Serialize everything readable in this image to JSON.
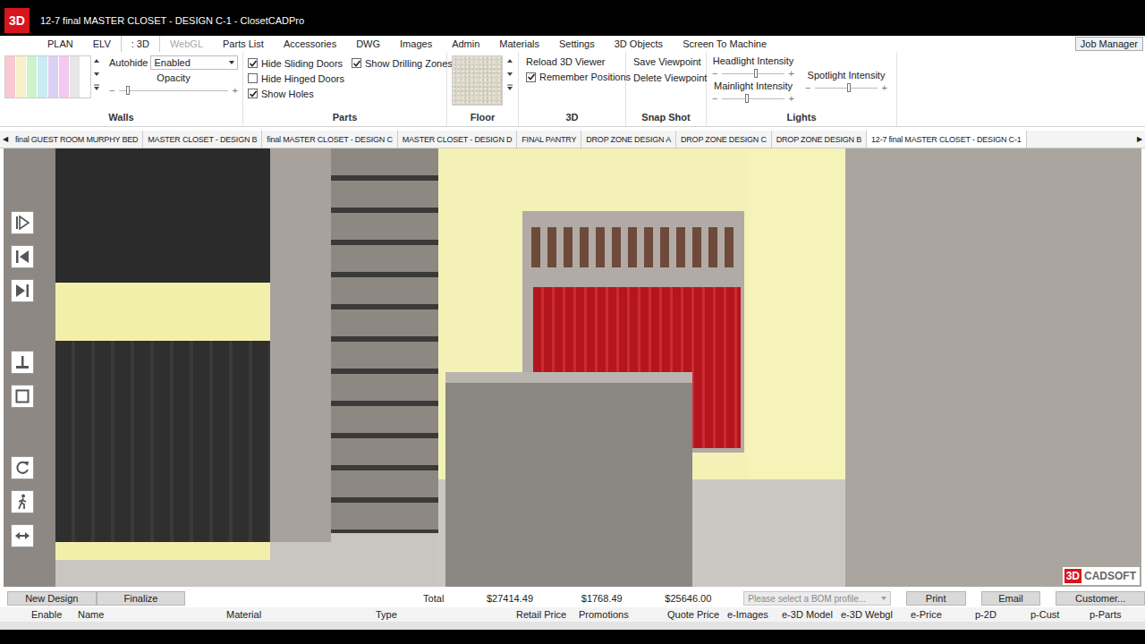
{
  "window": {
    "title": "12-7 final MASTER CLOSET - DESIGN C-1 - ClosetCADPro",
    "logo": "3D"
  },
  "menu": {
    "items": [
      {
        "label": "PLAN",
        "selected": false,
        "disabled": false
      },
      {
        "label": "ELV",
        "selected": false,
        "disabled": false
      },
      {
        "label": ": 3D",
        "selected": true,
        "disabled": false
      },
      {
        "label": "WebGL",
        "selected": false,
        "disabled": true
      },
      {
        "label": "Parts List",
        "selected": false,
        "disabled": false
      },
      {
        "label": "Accessories",
        "selected": false,
        "disabled": false
      },
      {
        "label": "DWG",
        "selected": false,
        "disabled": false
      },
      {
        "label": "Images",
        "selected": false,
        "disabled": false
      },
      {
        "label": "Admin",
        "selected": false,
        "disabled": false
      },
      {
        "label": "Materials",
        "selected": false,
        "disabled": false
      },
      {
        "label": "Settings",
        "selected": false,
        "disabled": false
      },
      {
        "label": "3D Objects",
        "selected": false,
        "disabled": false
      },
      {
        "label": "Screen To Machine",
        "selected": false,
        "disabled": false
      }
    ],
    "job_manager": "Job Manager"
  },
  "ribbon": {
    "slider_minus": "−",
    "slider_plus": "+",
    "walls": {
      "label": "Walls",
      "swatches": [
        {
          "color": "#f7c9d2"
        },
        {
          "color": "#f6f0c8"
        },
        {
          "color": "#cdf3cd"
        },
        {
          "color": "#c9ecf5"
        },
        {
          "color": "#dad1f5"
        },
        {
          "color": "#f4c8ef"
        },
        {
          "color": "#e6e6e6"
        },
        {
          "color": "#ffffff"
        }
      ],
      "autohide_label": "Autohide",
      "autohide_value": "Enabled",
      "opacity_label": "Opacity",
      "opacity_level": 0.08
    },
    "parts": {
      "label": "Parts",
      "options": [
        {
          "label": "Hide Sliding Doors",
          "checked": true
        },
        {
          "label": "Hide Hinged Doors",
          "checked": false
        },
        {
          "label": "Show Holes",
          "checked": true
        },
        {
          "label": "Show Drilling Zones",
          "checked": true
        }
      ]
    },
    "floor": {
      "label": "Floor"
    },
    "viewer": {
      "label": "3D",
      "reload": "Reload 3D Viewer",
      "remember": {
        "label": "Remember Positions",
        "checked": true
      }
    },
    "snapshot": {
      "label": "Snap Shot",
      "buttons": [
        "Save Viewpoint",
        "Delete Viewpoint"
      ]
    },
    "lights": {
      "label": "Lights",
      "sliders": [
        {
          "label": "Headlight Intensity",
          "level": 0.55
        },
        {
          "label": "Mainlight Intensity",
          "level": 0.4
        },
        {
          "label": "Spotlight Intensity",
          "level": 0.55
        }
      ]
    }
  },
  "tabs": {
    "prev": "◀",
    "next": "▶",
    "items": [
      {
        "label": "final GUEST ROOM MURPHY BED",
        "selected": false
      },
      {
        "label": "MASTER CLOSET - DESIGN B",
        "selected": false
      },
      {
        "label": "final MASTER CLOSET - DESIGN C",
        "selected": false
      },
      {
        "label": "MASTER CLOSET - DESIGN D",
        "selected": false
      },
      {
        "label": "FINAL PANTRY",
        "selected": false
      },
      {
        "label": "DROP ZONE DESIGN A",
        "selected": false
      },
      {
        "label": "DROP ZONE DESIGN C",
        "selected": false
      },
      {
        "label": "DROP ZONE DESIGN B",
        "selected": false
      },
      {
        "label": "12-7 final MASTER CLOSET - DESIGN C-1",
        "selected": true
      }
    ]
  },
  "viewport": {
    "logo_badge": "3D",
    "logo_text": "CADSOFT"
  },
  "footer": {
    "buttons_left": [
      "New Design",
      "Finalize"
    ],
    "total_label": "Total",
    "totals": [
      "$27414.49",
      "$1768.49",
      "$25646.00"
    ],
    "bom_placeholder": "Please select a BOM profile...",
    "buttons_right": [
      "Print",
      "Email",
      "Customer..."
    ]
  },
  "table": {
    "columns": [
      "Enable",
      "Name",
      "Material",
      "Type",
      "Retail Price",
      "Promotions",
      "Quote Price",
      "e-Images",
      "e-3D Model",
      "e-3D Webgl",
      "e-Price",
      "p-2D",
      "p-Cust",
      "p-Parts"
    ]
  }
}
